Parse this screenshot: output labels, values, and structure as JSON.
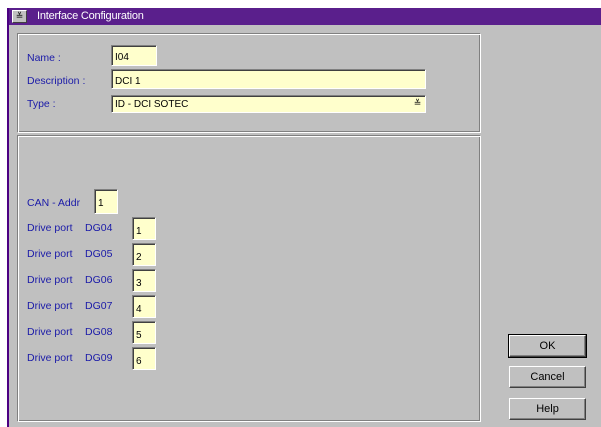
{
  "window": {
    "title": "Interface Configuration",
    "system_menu_glyph": "≚"
  },
  "form": {
    "name_label": "Name :",
    "name_value": "I04",
    "description_label": "Description :",
    "description_value": "DCI 1",
    "type_label": "Type :",
    "type_value": "ID  -  DCI SOTEC",
    "type_dropdown_glyph": "≚"
  },
  "can": {
    "label": "CAN - Addr",
    "value": "1"
  },
  "drive_ports": [
    {
      "label": "Drive port",
      "code": "DG04",
      "value": "1"
    },
    {
      "label": "Drive port",
      "code": "DG05",
      "value": "2"
    },
    {
      "label": "Drive port",
      "code": "DG06",
      "value": "3"
    },
    {
      "label": "Drive port",
      "code": "DG07",
      "value": "4"
    },
    {
      "label": "Drive port",
      "code": "DG08",
      "value": "5"
    },
    {
      "label": "Drive port",
      "code": "DG09",
      "value": "6"
    }
  ],
  "buttons": {
    "ok": "OK",
    "cancel": "Cancel",
    "help": "Help"
  }
}
